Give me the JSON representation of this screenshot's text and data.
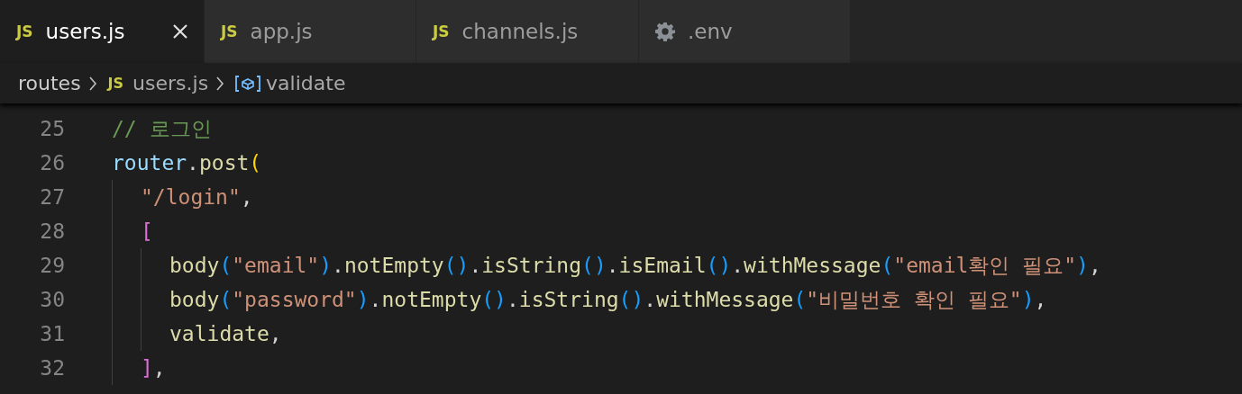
{
  "tabs": [
    {
      "label": "users.js",
      "kind": "js",
      "icon_text": "JS",
      "selected": true
    },
    {
      "label": "app.js",
      "kind": "js",
      "icon_text": "JS",
      "selected": false
    },
    {
      "label": "channels.js",
      "kind": "js",
      "icon_text": "JS",
      "selected": false
    },
    {
      "label": ".env",
      "kind": "gear",
      "selected": false
    }
  ],
  "breadcrumbs": [
    {
      "kind": "folder",
      "label": "routes"
    },
    {
      "kind": "file",
      "label": "users.js",
      "icon_text": "JS"
    },
    {
      "kind": "symbol",
      "label": "validate"
    }
  ],
  "lines": [
    {
      "number": "25",
      "tokens": [
        {
          "t": "// 로그인",
          "kind": "comment"
        }
      ]
    },
    {
      "number": "26",
      "tokens": [
        {
          "t": "router",
          "kind": "variable"
        },
        {
          "t": ".",
          "kind": "plain"
        },
        {
          "t": "post",
          "kind": "function"
        },
        {
          "t": "(",
          "kind": "bracket1"
        }
      ],
      "children": [
        {
          "number": "27",
          "tokens": [
            {
              "t": "\"/login\"",
              "kind": "string"
            },
            {
              "t": ",",
              "kind": "plain"
            }
          ]
        },
        {
          "number": "28",
          "tokens": [
            {
              "t": "[",
              "kind": "bracket2"
            }
          ],
          "children": [
            {
              "number": "29",
              "tokens": [
                {
                  "t": "body",
                  "kind": "function"
                },
                {
                  "t": "(",
                  "kind": "bracket3"
                },
                {
                  "t": "\"email\"",
                  "kind": "string"
                },
                {
                  "t": ")",
                  "kind": "bracket3"
                },
                {
                  "t": ".",
                  "kind": "plain"
                },
                {
                  "t": "notEmpty",
                  "kind": "function"
                },
                {
                  "t": "()",
                  "kind": "bracket3"
                },
                {
                  "t": ".",
                  "kind": "plain"
                },
                {
                  "t": "isString",
                  "kind": "function"
                },
                {
                  "t": "()",
                  "kind": "bracket3"
                },
                {
                  "t": ".",
                  "kind": "plain"
                },
                {
                  "t": "isEmail",
                  "kind": "function"
                },
                {
                  "t": "()",
                  "kind": "bracket3"
                },
                {
                  "t": ".",
                  "kind": "plain"
                },
                {
                  "t": "withMessage",
                  "kind": "function"
                },
                {
                  "t": "(",
                  "kind": "bracket3"
                },
                {
                  "t": "\"email확인 필요\"",
                  "kind": "string"
                },
                {
                  "t": ")",
                  "kind": "bracket3"
                },
                {
                  "t": ",",
                  "kind": "plain"
                }
              ]
            },
            {
              "number": "30",
              "tokens": [
                {
                  "t": "body",
                  "kind": "function"
                },
                {
                  "t": "(",
                  "kind": "bracket3"
                },
                {
                  "t": "\"password\"",
                  "kind": "string"
                },
                {
                  "t": ")",
                  "kind": "bracket3"
                },
                {
                  "t": ".",
                  "kind": "plain"
                },
                {
                  "t": "notEmpty",
                  "kind": "function"
                },
                {
                  "t": "()",
                  "kind": "bracket3"
                },
                {
                  "t": ".",
                  "kind": "plain"
                },
                {
                  "t": "isString",
                  "kind": "function"
                },
                {
                  "t": "()",
                  "kind": "bracket3"
                },
                {
                  "t": ".",
                  "kind": "plain"
                },
                {
                  "t": "withMessage",
                  "kind": "function"
                },
                {
                  "t": "(",
                  "kind": "bracket3"
                },
                {
                  "t": "\"비밀번호 확인 필요\"",
                  "kind": "string"
                },
                {
                  "t": ")",
                  "kind": "bracket3"
                },
                {
                  "t": ",",
                  "kind": "plain"
                }
              ]
            },
            {
              "number": "31",
              "tokens": [
                {
                  "t": "validate",
                  "kind": "function"
                },
                {
                  "t": ",",
                  "kind": "plain"
                }
              ]
            }
          ]
        },
        {
          "number": "32",
          "tokens": [
            {
              "t": "]",
              "kind": "bracket2"
            },
            {
              "t": ",",
              "kind": "plain"
            }
          ]
        }
      ]
    }
  ]
}
